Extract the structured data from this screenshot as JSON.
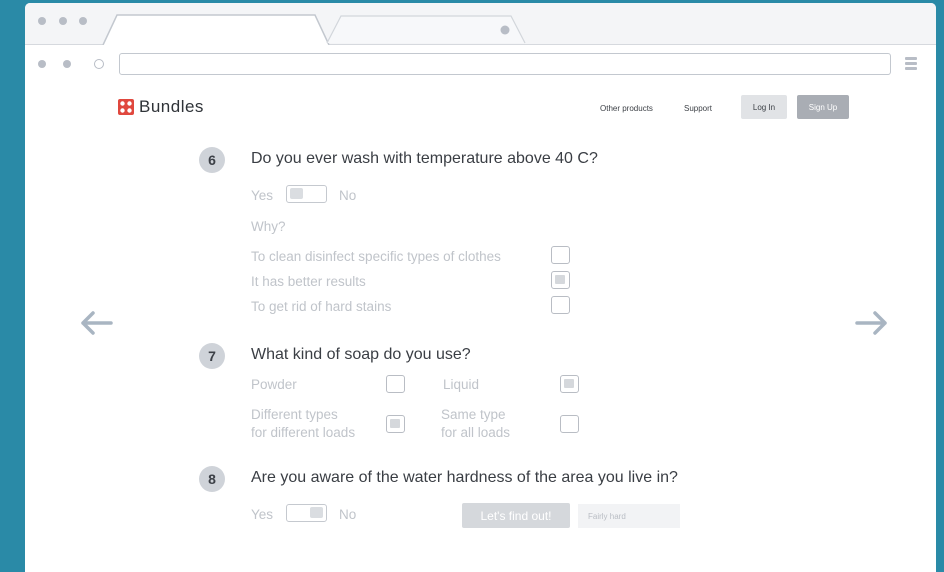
{
  "header": {
    "brand": "Bundles",
    "nav": [
      "Other products",
      "Support"
    ],
    "login_label": "Log In",
    "signup_label": "Sign Up"
  },
  "questions": [
    {
      "number": "6",
      "title": "Do you ever wash with temperature above 40 C?",
      "yes": "Yes",
      "no": "No",
      "why": "Why?",
      "options": [
        {
          "label": "To clean disinfect specific types of clothes",
          "checked": false
        },
        {
          "label": "It has better results",
          "checked": true
        },
        {
          "label": "To get rid of hard stains",
          "checked": false
        }
      ]
    },
    {
      "number": "7",
      "title": "What kind of soap do you use?",
      "options": [
        {
          "label": "Powder",
          "checked": false
        },
        {
          "label": "Liquid",
          "checked": true
        },
        {
          "label_line1": "Different types",
          "label_line2": "for different loads",
          "checked": true
        },
        {
          "label_line1": "Same type",
          "label_line2": "for all loads",
          "checked": false
        }
      ]
    },
    {
      "number": "8",
      "title": "Are you aware of the water hardness of the area you live in?",
      "yes": "Yes",
      "no": "No",
      "find_button": "Let's find out!",
      "result": "Fairly hard"
    }
  ],
  "icons": {
    "prev": "arrow-left-icon",
    "next": "arrow-right-icon",
    "menu": "hamburger-icon",
    "logo": "bundles-logo-icon"
  },
  "colors": {
    "background": "#2a8aa7",
    "brand": "#e0483e",
    "muted_text": "#c0c4ca",
    "arrow": "#a9b5c2"
  }
}
